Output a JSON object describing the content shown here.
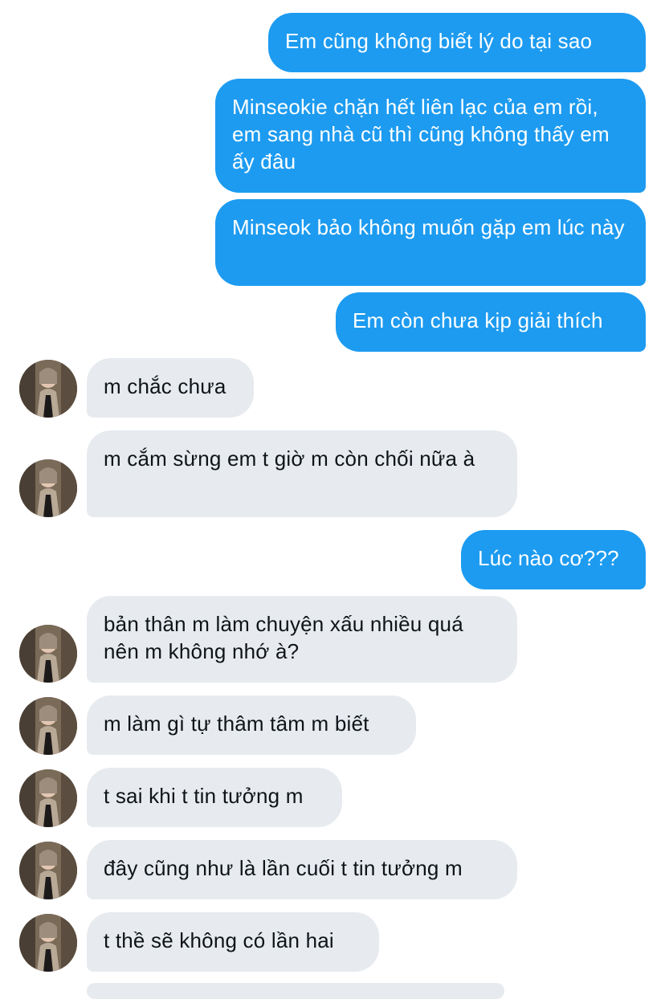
{
  "messages": [
    {
      "side": "out",
      "text": "Em cũng không biết lý do tại sao"
    },
    {
      "side": "out",
      "text": "Minseokie chặn hết liên lạc của em rồi, em sang nhà cũ thì cũng không thấy em ấy đâu"
    },
    {
      "side": "out",
      "text": "Minseok bảo không muốn gặp em lúc này"
    },
    {
      "side": "out",
      "text": "Em còn chưa kịp giải thích"
    },
    {
      "side": "in",
      "text": "m chắc chưa"
    },
    {
      "side": "in",
      "text": "m cắm sừng em t giờ m còn chối nữa à"
    },
    {
      "side": "out",
      "text": "Lúc nào cơ???"
    },
    {
      "side": "in",
      "text": "bản thân m làm chuyện xấu nhiều quá nên m không nhớ à?"
    },
    {
      "side": "in",
      "text": "m làm gì tự thâm tâm m biết"
    },
    {
      "side": "in",
      "text": "t sai khi t tin tưởng m"
    },
    {
      "side": "in",
      "text": "đây cũng như là lần cuối t tin tưởng m"
    },
    {
      "side": "in",
      "text": "t thề sẽ không có lần hai"
    }
  ],
  "colors": {
    "outgoing_bubble": "#1d9bf0",
    "incoming_bubble": "#e7ebef",
    "outgoing_text": "#ffffff",
    "incoming_text": "#0f1419"
  },
  "icons": {
    "avatar": "contact-avatar-photo"
  }
}
